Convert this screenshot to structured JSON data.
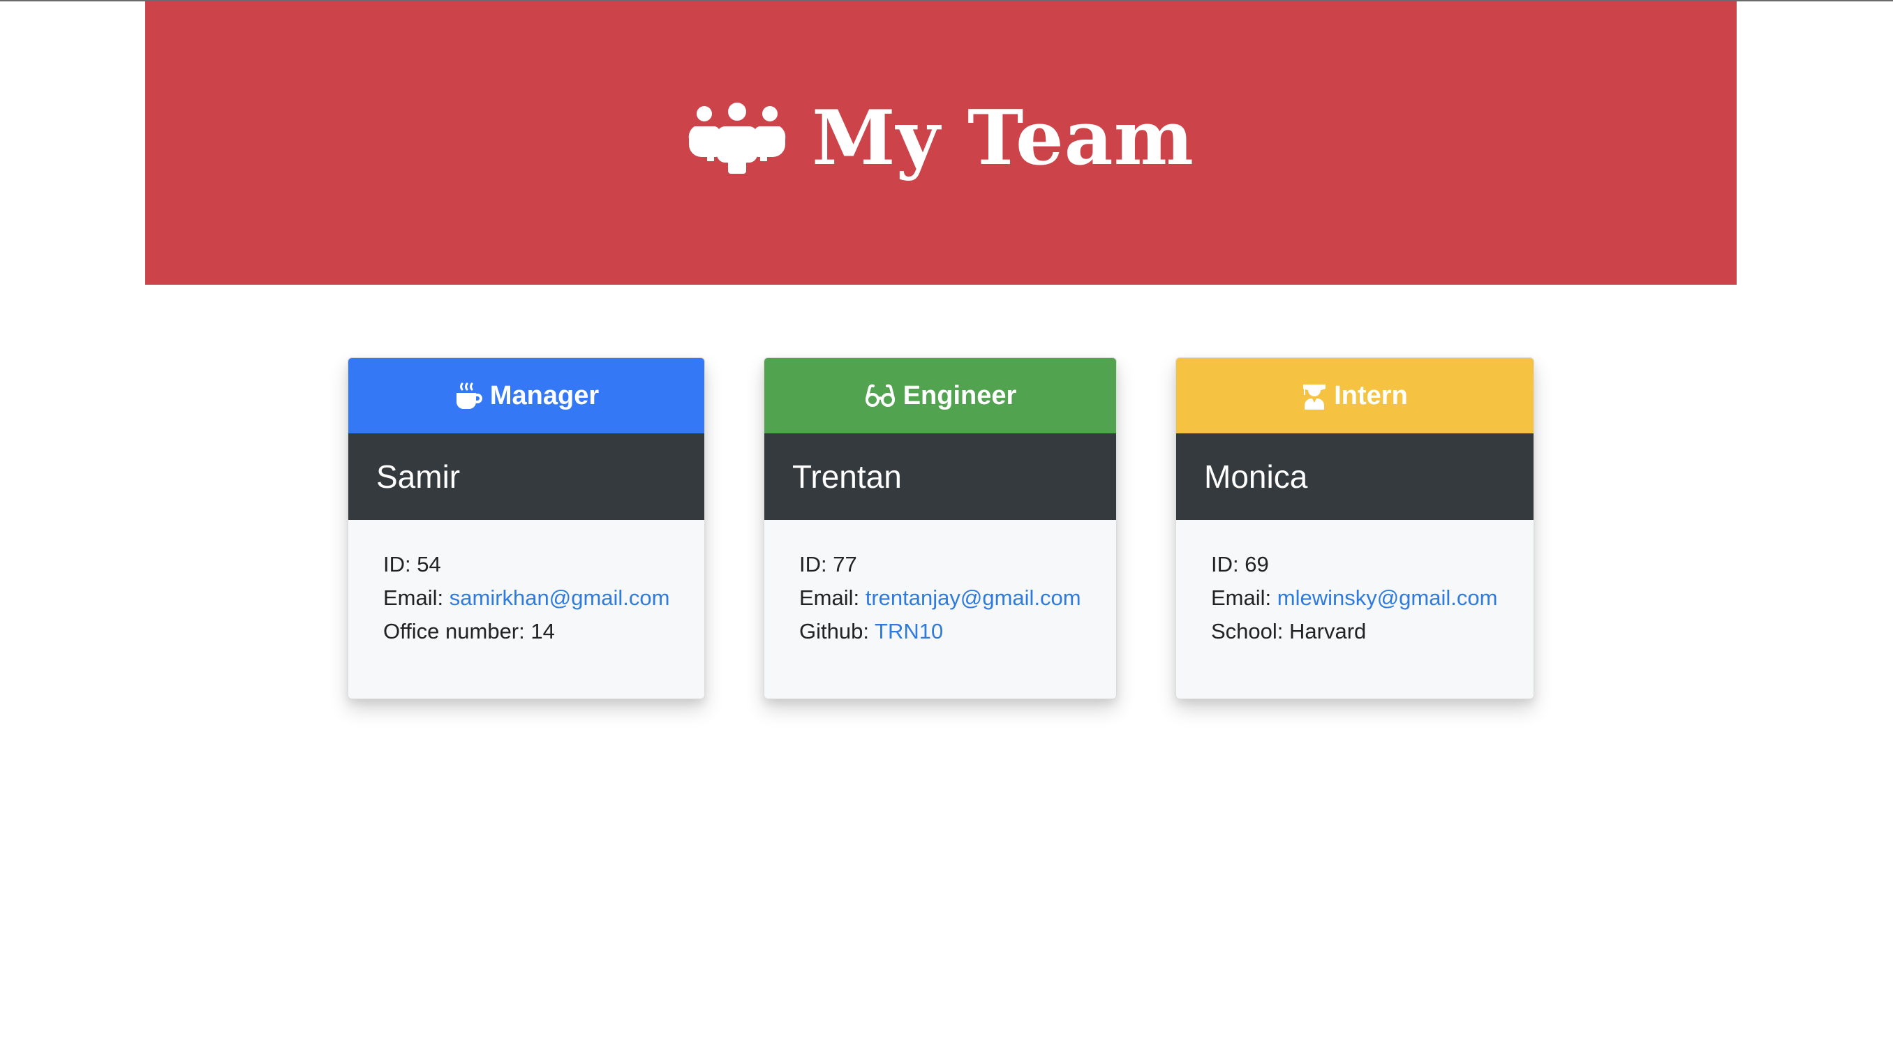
{
  "header": {
    "title": "My Team",
    "icon": "users-icon",
    "background": "#cc434a"
  },
  "cards": [
    {
      "role": "Manager",
      "role_icon": "mug-hot-icon",
      "role_color": "#3478f6",
      "name": "Samir",
      "id_label": "ID: ",
      "id": "54",
      "email_label": "Email: ",
      "email": "samirkhan@gmail.com",
      "extra_label": "Office number: ",
      "extra_value": "14"
    },
    {
      "role": "Engineer",
      "role_icon": "glasses-icon",
      "role_color": "#52a350",
      "name": "Trentan",
      "id_label": "ID: ",
      "id": "77",
      "email_label": "Email: ",
      "email": "trentanjay@gmail.com",
      "extra_label": "Github: ",
      "extra_value": "TRN10"
    },
    {
      "role": "Intern",
      "role_icon": "user-graduate-icon",
      "role_color": "#f5c242",
      "name": "Monica",
      "id_label": "ID: ",
      "id": "69",
      "email_label": "Email: ",
      "email": "mlewinsky@gmail.com",
      "extra_label": "School: ",
      "extra_value": "Harvard"
    }
  ]
}
